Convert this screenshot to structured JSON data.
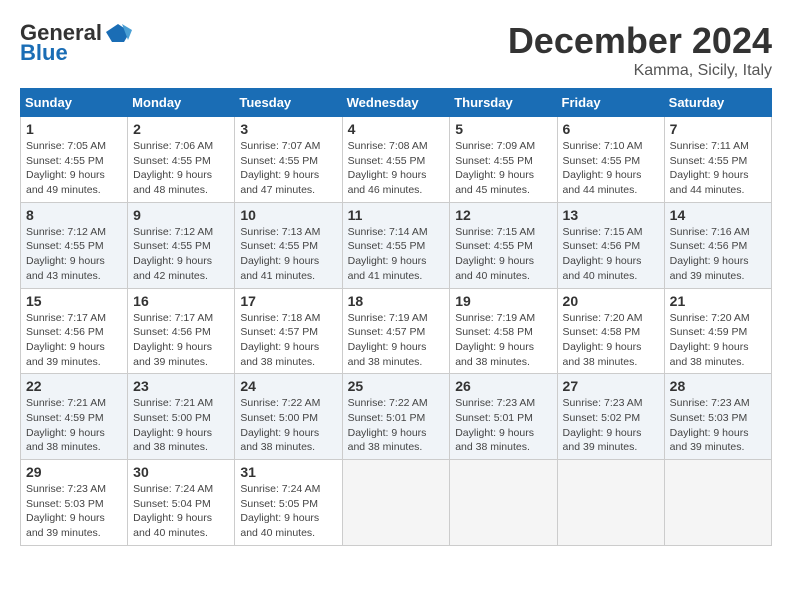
{
  "logo": {
    "general": "General",
    "blue": "Blue"
  },
  "header": {
    "title": "December 2024",
    "subtitle": "Kamma, Sicily, Italy"
  },
  "weekdays": [
    "Sunday",
    "Monday",
    "Tuesday",
    "Wednesday",
    "Thursday",
    "Friday",
    "Saturday"
  ],
  "weeks": [
    [
      {
        "day": "1",
        "sunrise": "7:05 AM",
        "sunset": "4:55 PM",
        "daylight": "9 hours and 49 minutes."
      },
      {
        "day": "2",
        "sunrise": "7:06 AM",
        "sunset": "4:55 PM",
        "daylight": "9 hours and 48 minutes."
      },
      {
        "day": "3",
        "sunrise": "7:07 AM",
        "sunset": "4:55 PM",
        "daylight": "9 hours and 47 minutes."
      },
      {
        "day": "4",
        "sunrise": "7:08 AM",
        "sunset": "4:55 PM",
        "daylight": "9 hours and 46 minutes."
      },
      {
        "day": "5",
        "sunrise": "7:09 AM",
        "sunset": "4:55 PM",
        "daylight": "9 hours and 45 minutes."
      },
      {
        "day": "6",
        "sunrise": "7:10 AM",
        "sunset": "4:55 PM",
        "daylight": "9 hours and 44 minutes."
      },
      {
        "day": "7",
        "sunrise": "7:11 AM",
        "sunset": "4:55 PM",
        "daylight": "9 hours and 44 minutes."
      }
    ],
    [
      {
        "day": "8",
        "sunrise": "7:12 AM",
        "sunset": "4:55 PM",
        "daylight": "9 hours and 43 minutes."
      },
      {
        "day": "9",
        "sunrise": "7:12 AM",
        "sunset": "4:55 PM",
        "daylight": "9 hours and 42 minutes."
      },
      {
        "day": "10",
        "sunrise": "7:13 AM",
        "sunset": "4:55 PM",
        "daylight": "9 hours and 41 minutes."
      },
      {
        "day": "11",
        "sunrise": "7:14 AM",
        "sunset": "4:55 PM",
        "daylight": "9 hours and 41 minutes."
      },
      {
        "day": "12",
        "sunrise": "7:15 AM",
        "sunset": "4:55 PM",
        "daylight": "9 hours and 40 minutes."
      },
      {
        "day": "13",
        "sunrise": "7:15 AM",
        "sunset": "4:56 PM",
        "daylight": "9 hours and 40 minutes."
      },
      {
        "day": "14",
        "sunrise": "7:16 AM",
        "sunset": "4:56 PM",
        "daylight": "9 hours and 39 minutes."
      }
    ],
    [
      {
        "day": "15",
        "sunrise": "7:17 AM",
        "sunset": "4:56 PM",
        "daylight": "9 hours and 39 minutes."
      },
      {
        "day": "16",
        "sunrise": "7:17 AM",
        "sunset": "4:56 PM",
        "daylight": "9 hours and 39 minutes."
      },
      {
        "day": "17",
        "sunrise": "7:18 AM",
        "sunset": "4:57 PM",
        "daylight": "9 hours and 38 minutes."
      },
      {
        "day": "18",
        "sunrise": "7:19 AM",
        "sunset": "4:57 PM",
        "daylight": "9 hours and 38 minutes."
      },
      {
        "day": "19",
        "sunrise": "7:19 AM",
        "sunset": "4:58 PM",
        "daylight": "9 hours and 38 minutes."
      },
      {
        "day": "20",
        "sunrise": "7:20 AM",
        "sunset": "4:58 PM",
        "daylight": "9 hours and 38 minutes."
      },
      {
        "day": "21",
        "sunrise": "7:20 AM",
        "sunset": "4:59 PM",
        "daylight": "9 hours and 38 minutes."
      }
    ],
    [
      {
        "day": "22",
        "sunrise": "7:21 AM",
        "sunset": "4:59 PM",
        "daylight": "9 hours and 38 minutes."
      },
      {
        "day": "23",
        "sunrise": "7:21 AM",
        "sunset": "5:00 PM",
        "daylight": "9 hours and 38 minutes."
      },
      {
        "day": "24",
        "sunrise": "7:22 AM",
        "sunset": "5:00 PM",
        "daylight": "9 hours and 38 minutes."
      },
      {
        "day": "25",
        "sunrise": "7:22 AM",
        "sunset": "5:01 PM",
        "daylight": "9 hours and 38 minutes."
      },
      {
        "day": "26",
        "sunrise": "7:23 AM",
        "sunset": "5:01 PM",
        "daylight": "9 hours and 38 minutes."
      },
      {
        "day": "27",
        "sunrise": "7:23 AM",
        "sunset": "5:02 PM",
        "daylight": "9 hours and 39 minutes."
      },
      {
        "day": "28",
        "sunrise": "7:23 AM",
        "sunset": "5:03 PM",
        "daylight": "9 hours and 39 minutes."
      }
    ],
    [
      {
        "day": "29",
        "sunrise": "7:23 AM",
        "sunset": "5:03 PM",
        "daylight": "9 hours and 39 minutes."
      },
      {
        "day": "30",
        "sunrise": "7:24 AM",
        "sunset": "5:04 PM",
        "daylight": "9 hours and 40 minutes."
      },
      {
        "day": "31",
        "sunrise": "7:24 AM",
        "sunset": "5:05 PM",
        "daylight": "9 hours and 40 minutes."
      },
      null,
      null,
      null,
      null
    ]
  ]
}
